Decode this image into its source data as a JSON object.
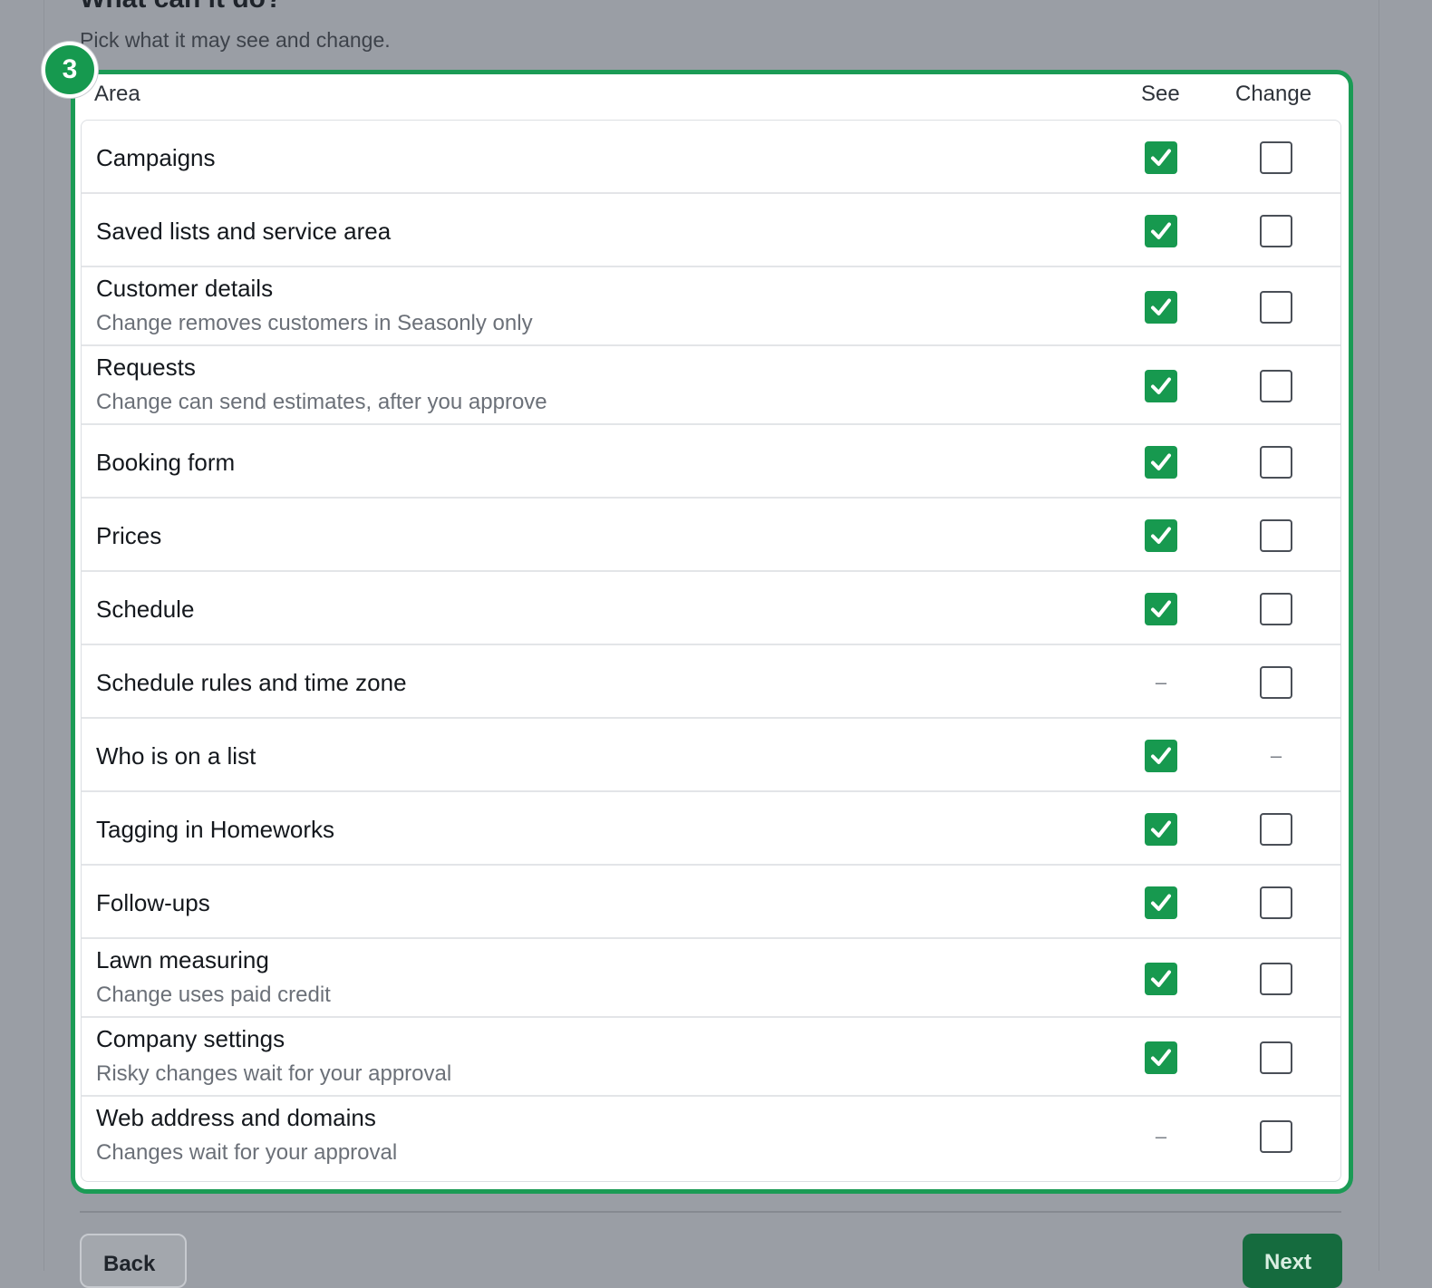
{
  "section": {
    "title": "What can it do?",
    "subtitle": "Pick what it may see and change."
  },
  "step_badge": "3",
  "table": {
    "headers": {
      "area": "Area",
      "see": "See",
      "change": "Change"
    },
    "rows": [
      {
        "label": "Campaigns",
        "hint": "",
        "see": "checked",
        "change": "unchecked"
      },
      {
        "label": "Saved lists and service area",
        "hint": "",
        "see": "checked",
        "change": "unchecked"
      },
      {
        "label": "Customer details",
        "hint": "Change removes customers in Seasonly only",
        "see": "checked",
        "change": "unchecked"
      },
      {
        "label": "Requests",
        "hint": "Change can send estimates, after you approve",
        "see": "checked",
        "change": "unchecked"
      },
      {
        "label": "Booking form",
        "hint": "",
        "see": "checked",
        "change": "unchecked"
      },
      {
        "label": "Prices",
        "hint": "",
        "see": "checked",
        "change": "unchecked"
      },
      {
        "label": "Schedule",
        "hint": "",
        "see": "checked",
        "change": "unchecked"
      },
      {
        "label": "Schedule rules and time zone",
        "hint": "",
        "see": "none",
        "change": "unchecked"
      },
      {
        "label": "Who is on a list",
        "hint": "",
        "see": "checked",
        "change": "none"
      },
      {
        "label": "Tagging in Homeworks",
        "hint": "",
        "see": "checked",
        "change": "unchecked"
      },
      {
        "label": "Follow-ups",
        "hint": "",
        "see": "checked",
        "change": "unchecked"
      },
      {
        "label": "Lawn measuring",
        "hint": "Change uses paid credit",
        "see": "checked",
        "change": "unchecked"
      },
      {
        "label": "Company settings",
        "hint": "Risky changes wait for your approval",
        "see": "checked",
        "change": "unchecked"
      },
      {
        "label": "Web address and domains",
        "hint": "Changes wait for your approval",
        "see": "none",
        "change": "unchecked"
      }
    ],
    "none_marker": "–"
  },
  "footer": {
    "back_label": "Back",
    "next_label": "Next"
  },
  "colors": {
    "accent": "#17994f",
    "highlight_border": "#1b9b55",
    "backdrop": "#9a9ea5"
  }
}
